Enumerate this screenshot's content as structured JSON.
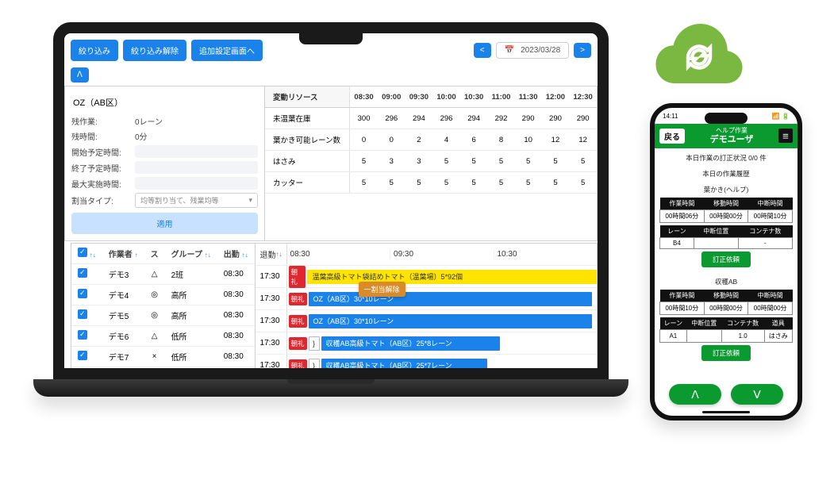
{
  "laptop": {
    "toolbar": {
      "filter": "絞り込み",
      "clear": "絞り込み解除",
      "addScreen": "追加設定画面へ",
      "date": "2023/03/28"
    },
    "left": {
      "title": "OZ（AB区）",
      "rows": [
        {
          "label": "残作業:",
          "value": "0レーン"
        },
        {
          "label": "残時間:",
          "value": "0分"
        },
        {
          "label": "開始予定時間:",
          "value": ""
        },
        {
          "label": "終了予定時間:",
          "value": ""
        },
        {
          "label": "最大実施時間:",
          "value": ""
        },
        {
          "label": "割当タイプ:",
          "value": ""
        }
      ],
      "selectPlaceholder": "均等割り当て、残業均等",
      "applyLabel": "適用"
    },
    "resource": {
      "header": [
        "変動リソース",
        "08:30",
        "09:00",
        "09:30",
        "10:00",
        "10:30",
        "11:00",
        "11:30",
        "12:00",
        "12:30"
      ],
      "rows": [
        {
          "name": "未温葉在庫",
          "vals": [
            "300",
            "296",
            "294",
            "296",
            "294",
            "292",
            "290",
            "290",
            "290"
          ]
        },
        {
          "name": "葉かき可能レーン数",
          "vals": [
            "0",
            "0",
            "2",
            "4",
            "6",
            "8",
            "10",
            "12",
            "12"
          ]
        },
        {
          "name": "はさみ",
          "vals": [
            "5",
            "3",
            "3",
            "5",
            "5",
            "5",
            "5",
            "5",
            "5"
          ]
        },
        {
          "name": "カッター",
          "vals": [
            "5",
            "5",
            "5",
            "5",
            "5",
            "5",
            "5",
            "5",
            "5"
          ]
        }
      ]
    },
    "schedule": {
      "cols": {
        "check": "",
        "worker": "作業者",
        "status": "ス",
        "group": "グループ",
        "arrive": "出勤",
        "leave": "退勤"
      },
      "time_ticks": [
        "08:30",
        "09:30",
        "10:30"
      ],
      "rows": [
        {
          "worker": "デモ3",
          "status": "△",
          "group": "2班",
          "arrive": "08:30",
          "leave": "17:30",
          "badge": "朝礼",
          "bar": {
            "color": "yellow",
            "width": "100%",
            "text": "温葉高級トマト袋詰めトマト（温葉場）5*92個"
          }
        },
        {
          "worker": "デモ4",
          "status": "◎",
          "group": "高所",
          "arrive": "08:30",
          "leave": "17:30",
          "badge": "朝礼",
          "bar": {
            "color": "blue",
            "width": "92%",
            "text": "OZ（AB区）30*10レーン"
          }
        },
        {
          "worker": "デモ5",
          "status": "◎",
          "group": "高所",
          "arrive": "08:30",
          "leave": "17:30",
          "badge": "朝礼",
          "bar": {
            "color": "blue",
            "width": "92%",
            "text": "OZ（AB区）30*10レーン"
          }
        },
        {
          "worker": "デモ6",
          "status": "△",
          "group": "低所",
          "arrive": "08:30",
          "leave": "17:30",
          "badge": "朝礼",
          "bar": {
            "color": "blue",
            "width": "58%",
            "text": "収穫AB高級トマト（AB区）25*8レーン",
            "pre": "}"
          }
        },
        {
          "worker": "デモ7",
          "status": "×",
          "group": "低所",
          "arrive": "08:30",
          "leave": "17:30",
          "badge": "朝礼",
          "bar": {
            "color": "blue",
            "width": "54%",
            "text": "収穫AB高級トマト（AB区）25*7レーン",
            "pre": "}"
          }
        }
      ],
      "popover": "一割当解除"
    }
  },
  "phone": {
    "status_time": "14:11",
    "header": {
      "back": "戻る",
      "sub": "ヘルプ作業",
      "main": "デモユーザ"
    },
    "revision_status": "本日作業の訂正状況 0/0 件",
    "history_title": "本日の作業履歴",
    "sections": [
      {
        "title": "葉かき(ヘルプ)",
        "table1": {
          "headers": [
            "作業時間",
            "移動時間",
            "中断時間"
          ],
          "values": [
            "00時間06分",
            "00時間00分",
            "00時間10分"
          ]
        },
        "table2": {
          "headers": [
            "レーン",
            "中断位置",
            "コンテナ数"
          ],
          "values": [
            "B4",
            "",
            "-"
          ]
        },
        "btn": "訂正依頼"
      },
      {
        "title": "収穫AB",
        "table1": {
          "headers": [
            "作業時間",
            "移動時間",
            "中断時間"
          ],
          "values": [
            "00時間10分",
            "00時間00分",
            "00時間00分"
          ]
        },
        "table2": {
          "headers": [
            "レーン",
            "中断位置",
            "コンテナ数",
            "道具"
          ],
          "values": [
            "A1",
            "",
            "1.0",
            "はさみ"
          ]
        },
        "btn": "訂正依頼"
      }
    ]
  }
}
